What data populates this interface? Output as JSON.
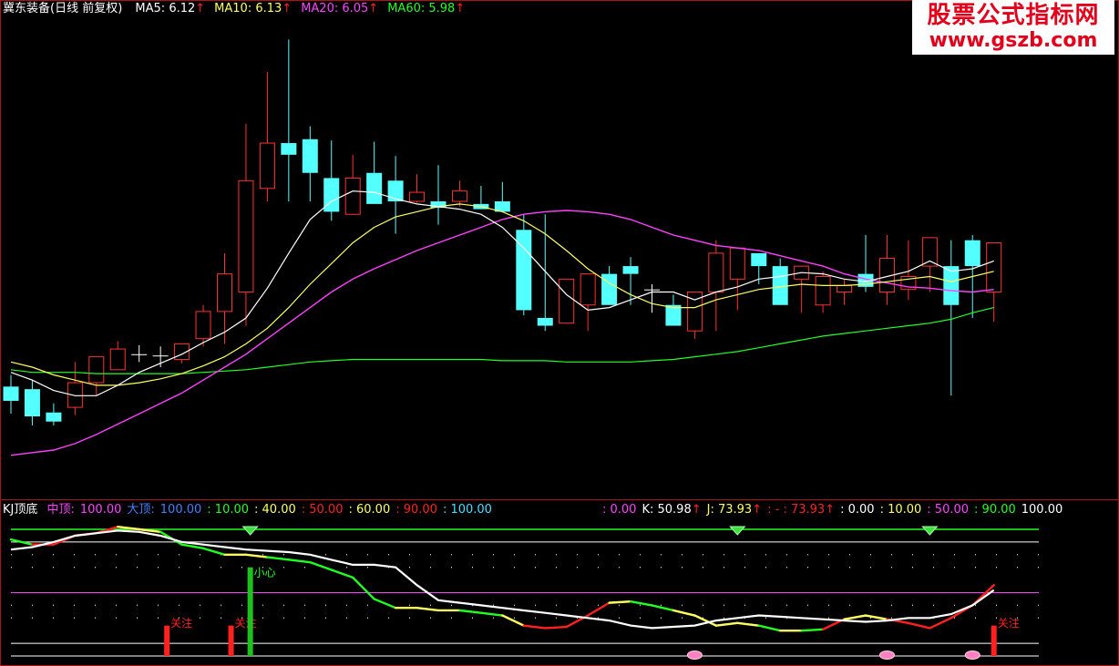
{
  "header": {
    "title": "冀东装备(日线 前复权)",
    "ma": [
      {
        "label": "MA5:",
        "value": "6.12",
        "arrow": "↑",
        "color": "#ffffff"
      },
      {
        "label": "MA10:",
        "value": "6.13",
        "arrow": "↑",
        "color": "#ffff60"
      },
      {
        "label": "MA20:",
        "value": "6.05",
        "arrow": "↑",
        "color": "#ff40ff"
      },
      {
        "label": "MA60:",
        "value": "5.98",
        "arrow": "↑",
        "color": "#20ff20"
      }
    ]
  },
  "watermark": {
    "line1": "股票公式指标网",
    "line2": "www.gszb.com"
  },
  "sub_header": {
    "title": "KJ顶底",
    "items_left": [
      {
        "text": "中顶:",
        "color": "#ff40ff"
      },
      {
        "text": "100.00",
        "color": "#ff40ff"
      },
      {
        "text": "大顶:",
        "color": "#4080ff"
      },
      {
        "text": "100.00",
        "color": "#4080ff"
      },
      {
        "text": ": 10.00",
        "color": "#20ff20"
      },
      {
        "text": ": 40.00",
        "color": "#ffff60"
      },
      {
        "text": ": 50.00",
        "color": "#ff2020"
      },
      {
        "text": ": 60.00",
        "color": "#ffff60"
      },
      {
        "text": ": 90.00",
        "color": "#ff2020"
      },
      {
        "text": ": 100.00",
        "color": "#40e0ff"
      }
    ],
    "items_right": [
      {
        "text": ": 0.00",
        "color": "#ff40ff"
      },
      {
        "text": "K: 50.98",
        "color": "#ffffff"
      },
      {
        "text": "↑",
        "color": "#ff2020"
      },
      {
        "text": "J: 73.93",
        "color": "#ffff60"
      },
      {
        "text": "↑",
        "color": "#ff2020"
      },
      {
        "text": ": - : 73.93",
        "color": "#ff2020"
      },
      {
        "text": "↑",
        "color": "#ff2020"
      },
      {
        "text": ": 0.00",
        "color": "#ffffff"
      },
      {
        "text": ": 10.00",
        "color": "#ffff60"
      },
      {
        "text": ": 50.00",
        "color": "#ff40ff"
      },
      {
        "text": ": 90.00",
        "color": "#20ff20"
      },
      {
        "text": "100.00",
        "color": "#ffffff"
      }
    ]
  },
  "annotations": {
    "focus": "关注",
    "careful": "小心"
  },
  "colors": {
    "up": "#ff3030",
    "down": "#54ffff",
    "ma5": "#ffffff",
    "ma10": "#ffff60",
    "ma20": "#ff40ff",
    "ma60": "#20ff20",
    "frame": "#b01010",
    "k": "#ffffff",
    "d_red": "#ff2020",
    "d_yellow": "#ffff60",
    "d_green": "#20ff20"
  },
  "chart_data": {
    "type": "candlestick",
    "ylim": [
      4.5,
      8.2
    ],
    "x": [
      1,
      2,
      3,
      4,
      5,
      6,
      7,
      8,
      9,
      10,
      11,
      12,
      13,
      14,
      15,
      16,
      17,
      18,
      19,
      20,
      21,
      22,
      23,
      24,
      25,
      26,
      27,
      28,
      29,
      30,
      31,
      32,
      33,
      34,
      35,
      36,
      37,
      38,
      39,
      40,
      41,
      42,
      43,
      44,
      45,
      46,
      47
    ],
    "open": [
      5.37,
      5.35,
      5.17,
      5.21,
      5.4,
      5.5,
      5.62,
      5.61,
      5.58,
      5.74,
      5.95,
      6.1,
      6.9,
      7.25,
      7.28,
      6.98,
      6.7,
      7.02,
      6.96,
      6.8,
      6.8,
      6.8,
      6.78,
      6.8,
      6.58,
      5.9,
      5.86,
      6.0,
      6.24,
      6.3,
      6.12,
      6.0,
      5.8,
      6.1,
      6.2,
      6.4,
      6.3,
      6.2,
      6.0,
      6.1,
      6.24,
      6.1,
      6.12,
      6.3,
      6.3,
      6.5,
      6.1
    ],
    "high": [
      5.46,
      5.42,
      5.24,
      5.56,
      5.6,
      5.72,
      5.69,
      5.68,
      5.7,
      6.0,
      6.4,
      7.4,
      7.8,
      8.05,
      7.38,
      7.27,
      7.16,
      7.26,
      7.15,
      7.01,
      7.08,
      6.96,
      6.92,
      6.95,
      6.7,
      6.7,
      6.06,
      6.2,
      6.3,
      6.37,
      6.16,
      6.08,
      6.02,
      6.5,
      6.4,
      6.4,
      6.36,
      6.3,
      6.26,
      6.2,
      6.54,
      6.54,
      6.5,
      6.5,
      6.5,
      6.54,
      6.44
    ],
    "low": [
      5.16,
      5.07,
      5.07,
      5.15,
      5.3,
      5.5,
      5.56,
      5.52,
      5.55,
      5.68,
      5.7,
      5.84,
      6.8,
      6.8,
      6.8,
      6.65,
      6.8,
      6.8,
      6.55,
      6.79,
      6.62,
      6.76,
      6.78,
      6.79,
      5.92,
      5.8,
      5.86,
      5.8,
      6.02,
      6.0,
      5.94,
      5.94,
      5.74,
      5.8,
      5.96,
      6.16,
      6.0,
      5.94,
      5.94,
      6.0,
      6.1,
      6.0,
      6.04,
      6.1,
      5.3,
      5.9,
      5.87
    ],
    "close": [
      5.26,
      5.14,
      5.1,
      5.4,
      5.6,
      5.66,
      5.62,
      5.61,
      5.7,
      5.95,
      6.24,
      6.96,
      7.25,
      7.16,
      7.02,
      6.72,
      6.98,
      6.78,
      6.8,
      6.87,
      6.75,
      6.88,
      6.74,
      6.72,
      5.96,
      5.84,
      6.2,
      6.24,
      6.0,
      6.24,
      6.12,
      5.84,
      6.1,
      6.4,
      6.44,
      6.3,
      6.0,
      6.3,
      6.22,
      6.15,
      6.14,
      6.36,
      6.22,
      6.52,
      6.0,
      6.3,
      6.48
    ],
    "ma5": [
      5.48,
      5.42,
      5.34,
      5.3,
      5.3,
      5.38,
      5.48,
      5.55,
      5.62,
      5.71,
      5.79,
      5.9,
      6.13,
      6.4,
      6.66,
      6.8,
      6.88,
      6.87,
      6.82,
      6.78,
      6.76,
      6.74,
      6.7,
      6.6,
      6.44,
      6.26,
      6.08,
      5.96,
      5.98,
      6.04,
      6.1,
      6.1,
      6.04,
      6.1,
      6.14,
      6.2,
      6.22,
      6.25,
      6.24,
      6.2,
      6.18,
      6.22,
      6.26,
      6.34,
      6.26,
      6.28,
      6.34
    ],
    "ma10": [
      5.56,
      5.52,
      5.46,
      5.42,
      5.38,
      5.38,
      5.4,
      5.43,
      5.47,
      5.53,
      5.6,
      5.7,
      5.82,
      5.98,
      6.16,
      6.32,
      6.48,
      6.6,
      6.68,
      6.72,
      6.76,
      6.78,
      6.76,
      6.72,
      6.65,
      6.55,
      6.42,
      6.28,
      6.17,
      6.08,
      6.01,
      5.98,
      5.98,
      6.04,
      6.08,
      6.12,
      6.14,
      6.16,
      6.15,
      6.15,
      6.16,
      6.18,
      6.2,
      6.22,
      6.18,
      6.22,
      6.26
    ],
    "ma20": [
      4.84,
      4.86,
      4.88,
      4.93,
      5.0,
      5.08,
      5.16,
      5.24,
      5.32,
      5.42,
      5.52,
      5.62,
      5.74,
      5.86,
      5.98,
      6.1,
      6.2,
      6.28,
      6.35,
      6.42,
      6.48,
      6.54,
      6.6,
      6.66,
      6.7,
      6.72,
      6.73,
      6.72,
      6.7,
      6.66,
      6.6,
      6.54,
      6.5,
      6.46,
      6.44,
      6.42,
      6.38,
      6.34,
      6.3,
      6.24,
      6.2,
      6.17,
      6.14,
      6.13,
      6.11,
      6.1,
      6.12
    ],
    "ma60": [
      5.5,
      5.48,
      5.48,
      5.48,
      5.47,
      5.47,
      5.47,
      5.47,
      5.47,
      5.48,
      5.49,
      5.5,
      5.52,
      5.54,
      5.56,
      5.57,
      5.58,
      5.58,
      5.58,
      5.58,
      5.58,
      5.58,
      5.58,
      5.57,
      5.57,
      5.57,
      5.56,
      5.56,
      5.56,
      5.56,
      5.57,
      5.58,
      5.6,
      5.62,
      5.64,
      5.67,
      5.7,
      5.73,
      5.76,
      5.78,
      5.8,
      5.82,
      5.84,
      5.86,
      5.89,
      5.94,
      5.98
    ],
    "sub": {
      "ylim": [
        0,
        100
      ],
      "k": [
        84,
        86,
        90,
        95,
        97,
        99,
        98,
        95,
        90,
        88,
        86,
        84,
        83,
        82,
        80,
        76,
        72,
        72,
        70,
        56,
        44,
        42,
        40,
        38,
        36,
        34,
        32,
        30,
        28,
        24,
        22,
        23,
        24,
        28,
        30,
        32,
        31,
        30,
        29,
        28,
        27,
        28,
        30,
        30,
        33,
        40,
        52
      ],
      "d": [
        92,
        88,
        88,
        95,
        97,
        102,
        100,
        98,
        88,
        85,
        80,
        80,
        78,
        76,
        74,
        68,
        62,
        45,
        38,
        38,
        36,
        36,
        34,
        32,
        24,
        22,
        23,
        32,
        42,
        43,
        40,
        36,
        32,
        24,
        26,
        24,
        20,
        20,
        21,
        29,
        32,
        29,
        26,
        22,
        30,
        40,
        56
      ],
      "d_colors": [
        "green",
        "green",
        "red",
        "red",
        "red",
        "red",
        "yellow",
        "yellow",
        "green",
        "green",
        "green",
        "yellow",
        "yellow",
        "green",
        "green",
        "green",
        "green",
        "green",
        "green",
        "yellow",
        "yellow",
        "yellow",
        "green",
        "green",
        "yellow",
        "red",
        "red",
        "red",
        "red",
        "yellow",
        "green",
        "green",
        "yellow",
        "yellow",
        "yellow",
        "yellow",
        "green",
        "yellow",
        "green",
        "red",
        "yellow",
        "yellow",
        "red",
        "red",
        "red",
        "red",
        "red"
      ],
      "focus_at": [
        8.3,
        11.3,
        47
      ],
      "careful_at": 12.2,
      "top_diamonds_at": [
        12.2,
        35,
        44
      ],
      "bottom_marks_at": [
        33,
        42,
        46
      ]
    }
  }
}
